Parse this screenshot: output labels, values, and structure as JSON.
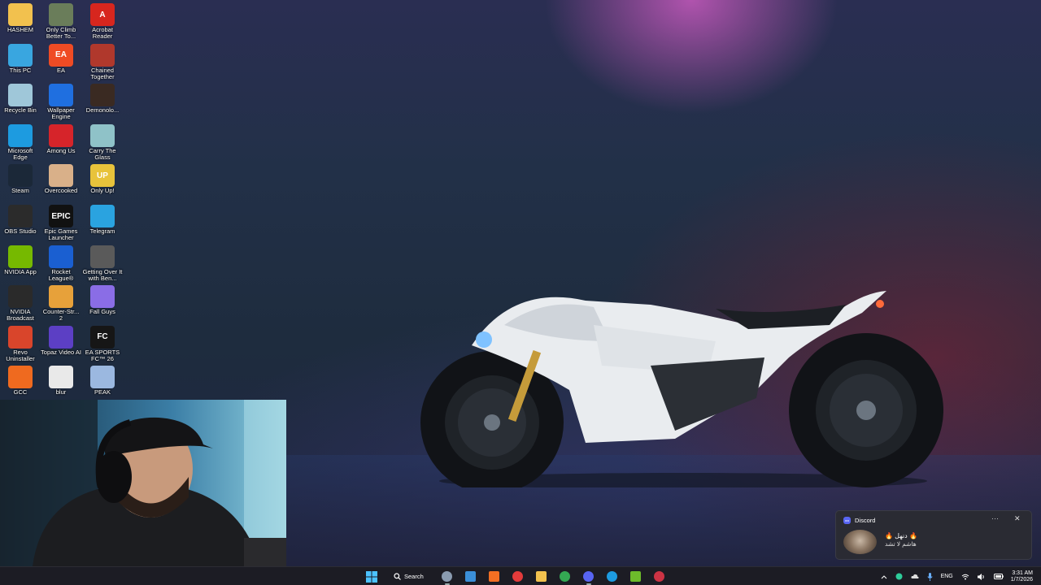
{
  "desktop_icons": [
    {
      "label": "HASHEM",
      "color": "#f2c14e",
      "glyph": ""
    },
    {
      "label": "Only Climb Better To...",
      "color": "#6a7d5a",
      "glyph": ""
    },
    {
      "label": "Acrobat Reader",
      "color": "#d7261e",
      "glyph": "A"
    },
    {
      "label": "This PC",
      "color": "#39a6e0",
      "glyph": ""
    },
    {
      "label": "EA",
      "color": "#ef4b24",
      "glyph": "EA"
    },
    {
      "label": "Chained Together",
      "color": "#b0382c",
      "glyph": ""
    },
    {
      "label": "Recycle Bin",
      "color": "#9fc7d9",
      "glyph": ""
    },
    {
      "label": "Wallpaper Engine",
      "color": "#1f6fe0",
      "glyph": ""
    },
    {
      "label": "Demonolo...",
      "color": "#3a2a22",
      "glyph": ""
    },
    {
      "label": "Microsoft Edge",
      "color": "#1d9be0",
      "glyph": ""
    },
    {
      "label": "Among Us",
      "color": "#d6242a",
      "glyph": ""
    },
    {
      "label": "Carry The Glass",
      "color": "#8fc2c8",
      "glyph": ""
    },
    {
      "label": "Steam",
      "color": "#1b2838",
      "glyph": ""
    },
    {
      "label": "Overcooked",
      "color": "#d9b089",
      "glyph": ""
    },
    {
      "label": "Only Up!",
      "color": "#e8c33b",
      "glyph": "UP"
    },
    {
      "label": "OBS Studio",
      "color": "#2b2b2b",
      "glyph": ""
    },
    {
      "label": "Epic Games Launcher",
      "color": "#111111",
      "glyph": "EPIC"
    },
    {
      "label": "Telegram",
      "color": "#2aa3e0",
      "glyph": ""
    },
    {
      "label": "NVIDIA App",
      "color": "#76b900",
      "glyph": ""
    },
    {
      "label": "Rocket League®",
      "color": "#1a5fd1",
      "glyph": ""
    },
    {
      "label": "Getting Over It with Ben...",
      "color": "#5a5a5a",
      "glyph": ""
    },
    {
      "label": "NVIDIA Broadcast",
      "color": "#2a2a2a",
      "glyph": ""
    },
    {
      "label": "Counter-Str... 2",
      "color": "#e7a13a",
      "glyph": ""
    },
    {
      "label": "Fall Guys",
      "color": "#8a6de6",
      "glyph": ""
    },
    {
      "label": "Revo Uninstaller",
      "color": "#d9452b",
      "glyph": ""
    },
    {
      "label": "Topaz Video AI",
      "color": "#5c3fc4",
      "glyph": ""
    },
    {
      "label": "EA SPORTS FC™ 26",
      "color": "#161616",
      "glyph": "FC"
    },
    {
      "label": "GCC",
      "color": "#ef6a1f",
      "glyph": ""
    },
    {
      "label": "blur",
      "color": "#e9e9e9",
      "glyph": ""
    },
    {
      "label": "PEAK",
      "color": "#9bb8e0",
      "glyph": ""
    }
  ],
  "taskbar": {
    "search_label": "Search",
    "apps": [
      {
        "name": "settings",
        "color": "#8a9bb0"
      },
      {
        "name": "photos",
        "color": "#3b8fd8"
      },
      {
        "name": "soundcloud",
        "color": "#f26f23"
      },
      {
        "name": "cpu-tool",
        "color": "#e33b3b"
      },
      {
        "name": "file-explorer",
        "color": "#f2c14e"
      },
      {
        "name": "chrome",
        "color": "#34a853"
      },
      {
        "name": "discord",
        "color": "#5865f2"
      },
      {
        "name": "edge",
        "color": "#1d9be0"
      },
      {
        "name": "play-app",
        "color": "#6dbb2b"
      },
      {
        "name": "record-app",
        "color": "#cc3344"
      }
    ],
    "tray": {
      "language": "ENG",
      "time": "3:31 AM",
      "date": "1/7/2026"
    }
  },
  "notification": {
    "app": "Discord",
    "title": "🔥 دنهل 🔥",
    "message": "هاشم لا تشد",
    "more": "···",
    "close": "✕"
  }
}
